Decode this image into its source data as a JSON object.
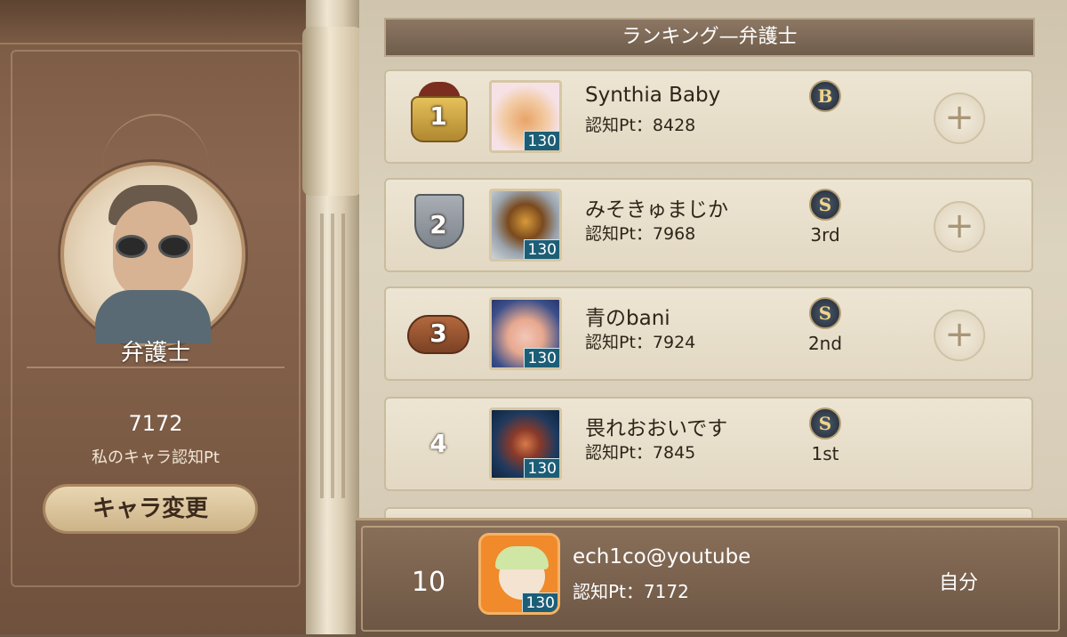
{
  "title": "ランキング—弁護士",
  "character": {
    "name": "弁護士",
    "my_pt": "7172",
    "my_pt_label": "私のキャラ認知Pt",
    "change_button": "キャラ変更"
  },
  "rows": [
    {
      "rank": "1",
      "name": "Synthia Baby",
      "pt": "認知Pt：8428",
      "tier_badge": "B",
      "tier_text": "",
      "level": "130",
      "has_add": true
    },
    {
      "rank": "2",
      "name": "みそきゅまじか",
      "pt": "認知Pt：7968",
      "tier_badge": "S",
      "tier_text": "3rd",
      "level": "130",
      "has_add": true
    },
    {
      "rank": "3",
      "name": "青のbani",
      "pt": "認知Pt：7924",
      "tier_badge": "S",
      "tier_text": "2nd",
      "level": "130",
      "has_add": true
    },
    {
      "rank": "4",
      "name": "畏れおおいです",
      "pt": "認知Pt：7845",
      "tier_badge": "S",
      "tier_text": "1st",
      "level": "130",
      "has_add": false
    }
  ],
  "self": {
    "rank": "10",
    "name": "ech1co@youtube",
    "pt": "認知Pt：7172",
    "level": "130",
    "label": "自分"
  },
  "icons": {
    "add": "+",
    "rank1": "crown-icon",
    "rank2": "top-hat-icon",
    "rank3": "fedora-icon"
  },
  "colors": {
    "title_bar": "#7a6552",
    "level_badge": "#1d5e77",
    "self_portrait_bg": "#f08a2a"
  }
}
